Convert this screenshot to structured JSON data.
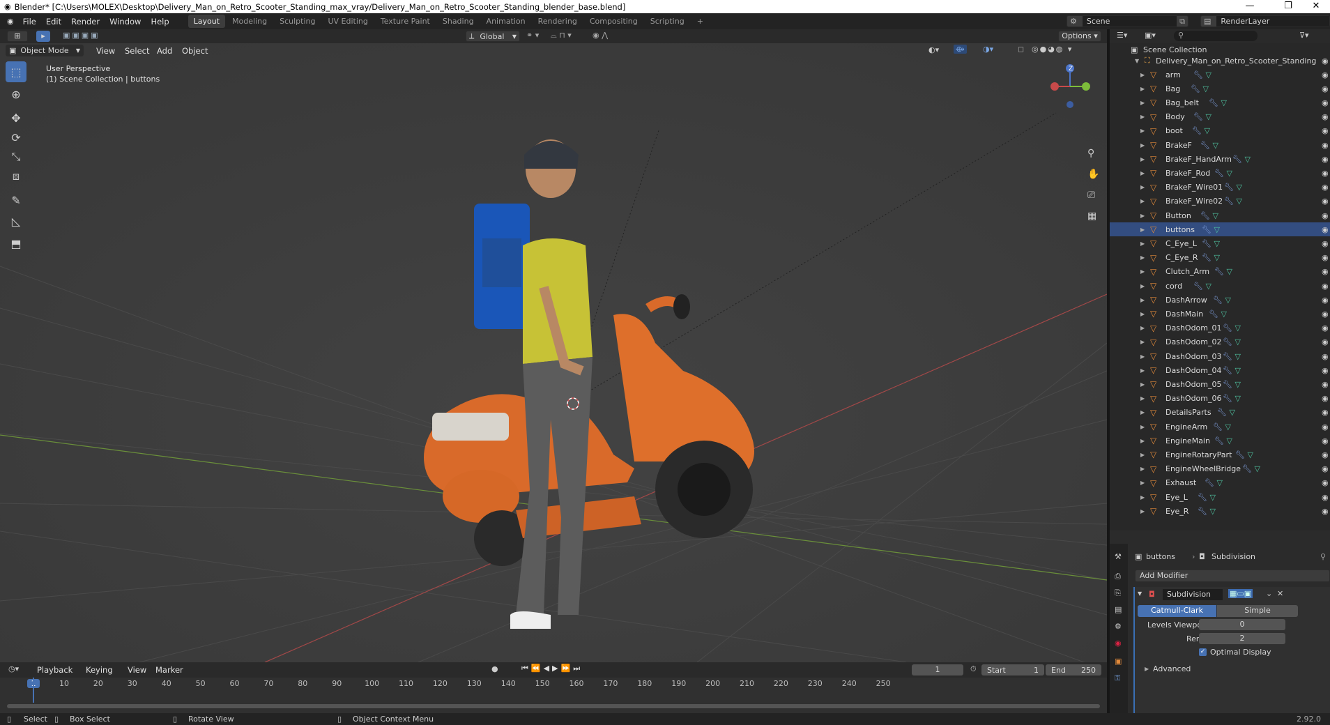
{
  "window": {
    "title": "Blender* [C:\\Users\\MOLEX\\Desktop\\Delivery_Man_on_Retro_Scooter_Standing_max_vray/Delivery_Man_on_Retro_Scooter_Standing_blender_base.blend]",
    "minimize": "—",
    "maximize": "❐",
    "close": "✕"
  },
  "menu": [
    "File",
    "Edit",
    "Render",
    "Window",
    "Help"
  ],
  "workspaces": [
    "Layout",
    "Modeling",
    "Sculpting",
    "UV Editing",
    "Texture Paint",
    "Shading",
    "Animation",
    "Rendering",
    "Compositing",
    "Scripting"
  ],
  "workspace_add": "+",
  "scene": {
    "label": "Scene",
    "layer": "RenderLayer"
  },
  "viewport": {
    "mode": "Object Mode",
    "menus": [
      "View",
      "Select",
      "Add",
      "Object"
    ],
    "transform": "Global",
    "options": "Options",
    "perspective": "User Perspective",
    "collection": "(1) Scene Collection | buttons",
    "gizmo": {
      "z": "Z",
      "x": "X",
      "y": "Y"
    }
  },
  "tools": [
    "select-box-tool",
    "cursor-tool",
    "move-tool",
    "rotate-tool",
    "scale-tool",
    "transform-tool",
    "annotate-tool",
    "measure-tool",
    "add-cube-tool"
  ],
  "outliner": {
    "root": "Scene Collection",
    "collection": "Delivery_Man_on_Retro_Scooter_Standing",
    "items": [
      "arm",
      "Bag",
      "Bag_belt",
      "Body",
      "boot",
      "BrakeF",
      "BrakeF_HandArm",
      "BrakeF_Rod",
      "BrakeF_Wire01",
      "BrakeF_Wire02",
      "Button",
      "buttons",
      "C_Eye_L",
      "C_Eye_R",
      "Clutch_Arm",
      "cord",
      "DashArrow",
      "DashMain",
      "DashOdom_01",
      "DashOdom_02",
      "DashOdom_03",
      "DashOdom_04",
      "DashOdom_05",
      "DashOdom_06",
      "DetailsParts",
      "EngineArm",
      "EngineMain",
      "EngineRotaryPart",
      "EngineWheelBridge",
      "Exhaust",
      "Eye_L",
      "Eye_R"
    ]
  },
  "properties": {
    "object": "buttons",
    "modifier_tab": "Subdivision",
    "add_modifier": "Add Modifier",
    "modifier_name": "Subdivision",
    "catmull": "Catmull-Clark",
    "simple": "Simple",
    "levels_viewport_label": "Levels Viewport",
    "levels_viewport": "0",
    "render_label": "Render",
    "render": "2",
    "optimal_display": "Optimal Display",
    "advanced": "Advanced"
  },
  "timeline": {
    "menus": [
      "Playback",
      "Keying",
      "View",
      "Marker"
    ],
    "current_frame": "1",
    "start_label": "Start",
    "start": "1",
    "end_label": "End",
    "end": "250",
    "ticks": [
      "1",
      "10",
      "20",
      "30",
      "40",
      "50",
      "60",
      "70",
      "80",
      "90",
      "100",
      "110",
      "120",
      "130",
      "140",
      "150",
      "160",
      "170",
      "180",
      "190",
      "200",
      "210",
      "220",
      "230",
      "240",
      "250"
    ]
  },
  "status": {
    "select": "Select",
    "box_select": "Box Select",
    "rotate_view": "Rotate View",
    "context_menu": "Object Context Menu",
    "version": "2.92.0"
  }
}
